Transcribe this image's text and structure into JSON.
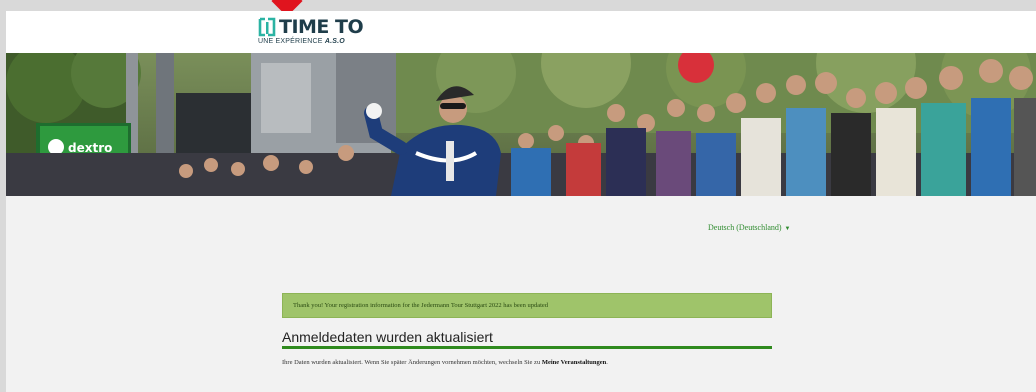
{
  "header": {
    "logo_word": "TIME TO",
    "logo_tagline_prefix": "UNE EXPÉRIENCE",
    "logo_tagline_brand": "A.S.O",
    "colors": {
      "logo": "#1f3d4a",
      "accent_red": "#e0141e"
    }
  },
  "hero": {
    "image": "cyclist-finish-crowd-photo",
    "banner_text": "dextro"
  },
  "language": {
    "selected": "Deutsch (Deutschland)",
    "icon": "caret-down-icon"
  },
  "alert": {
    "message": "Thank you! Your registration information for the Jedermann Tour Stuttgart 2022 has been updated",
    "color": "#9fc46a"
  },
  "content": {
    "title": "Anmeldedaten wurden aktualisiert",
    "text_before_link": "Ihre Daten wurden aktualisiert. Wenn Sie später Änderungen vornehmen möchten, wechseln Sie zu ",
    "link_text": "Meine Veranstaltungen",
    "text_after_link": ".",
    "accent_color": "#2f8a1e"
  }
}
